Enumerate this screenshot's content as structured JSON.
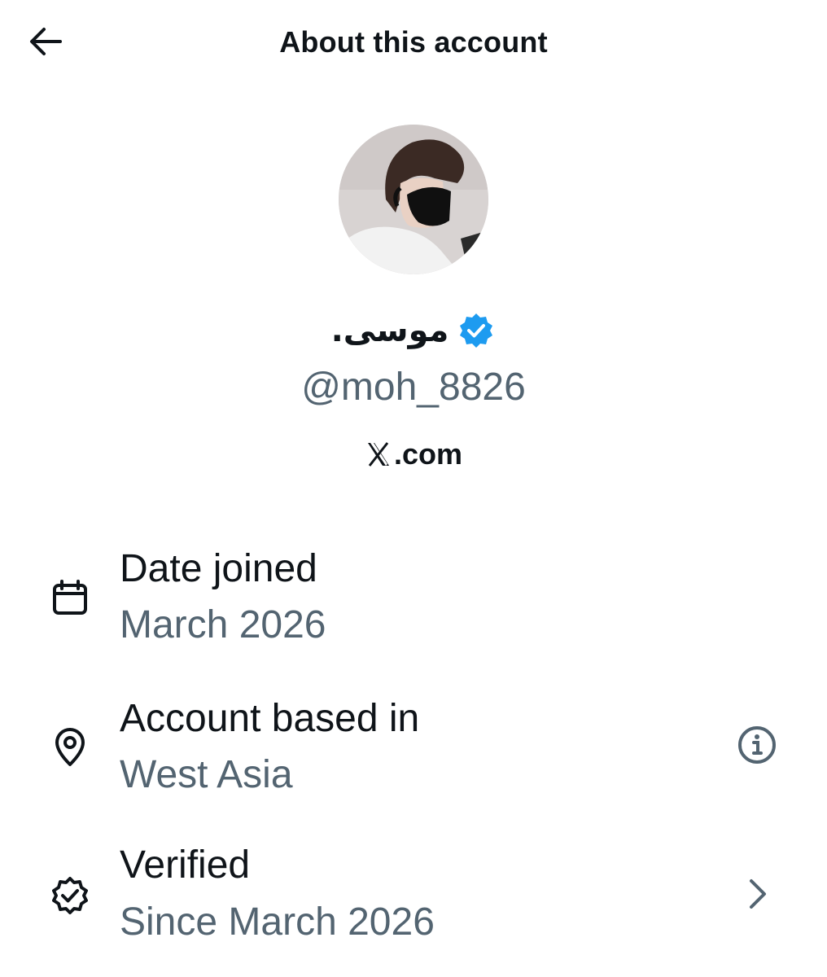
{
  "header": {
    "title": "About this account",
    "back_icon": "arrow-left-icon"
  },
  "profile": {
    "display_name": "موسى.",
    "verified_icon": "verified-badge-icon",
    "verified_color": "#1d9bf0",
    "handle": "@moh_8826",
    "site_logo": "x-logo-icon",
    "site_label": ".com"
  },
  "rows": [
    {
      "icon": "calendar-icon",
      "title": "Date joined",
      "value": "March 2026"
    },
    {
      "icon": "location-pin-icon",
      "title": "Account based in",
      "value": "West Asia",
      "action_icon": "info-icon"
    },
    {
      "icon": "verified-outline-icon",
      "title": "Verified",
      "value": "Since March 2026",
      "action_icon": "chevron-right-icon"
    }
  ],
  "colors": {
    "text_primary": "#0f1419",
    "text_secondary": "#536471",
    "accent": "#1d9bf0"
  }
}
